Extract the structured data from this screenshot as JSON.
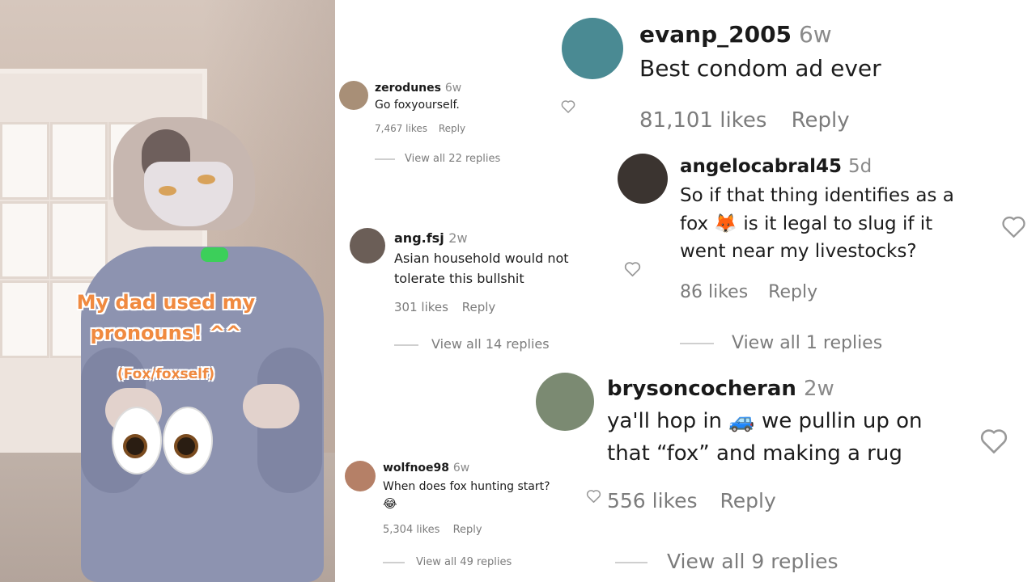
{
  "video": {
    "caption_main": "My dad used my pronouns! ^^",
    "caption_sub": "(Fox/foxself)"
  },
  "comments": [
    {
      "username": "zerodunes",
      "age": "6w",
      "text": "Go foxyourself.",
      "likes": "7,467 likes",
      "reply": "Reply",
      "view_all": "View all 22 replies"
    },
    {
      "username": "ang.fsj",
      "age": "2w",
      "text_line1": "Asian household would not",
      "text_line2": "tolerate this bullshit",
      "likes": "301 likes",
      "reply": "Reply",
      "view_all": "View all 14 replies"
    },
    {
      "username": "wolfnoe98",
      "age": "6w",
      "text": "When does fox hunting start?",
      "emoji": "😂",
      "likes": "5,304 likes",
      "reply": "Reply",
      "view_all": "View all 49 replies"
    },
    {
      "username": "evanp_2005",
      "age": "6w",
      "text": "Best condom ad ever",
      "likes": "81,101 likes",
      "reply": "Reply"
    },
    {
      "username": "angelocabral45",
      "age": "5d",
      "text_line1": "So if that thing identifies as a",
      "text_line2a": "fox",
      "emoji": "🦊",
      "text_line2b": "is it legal to slug if it",
      "text_line3": "went near my livestocks?",
      "likes": "86 likes",
      "reply": "Reply",
      "view_all": "View all 1 replies"
    },
    {
      "username": "brysoncocheran",
      "age": "2w",
      "text_line1a": "ya'll hop in",
      "emoji": "🚙",
      "text_line1b": "we pullin up on",
      "text_line2": "that “fox” and making a rug",
      "likes": "556 likes",
      "reply": "Reply",
      "view_all": "View all 9 replies"
    }
  ],
  "icons": {
    "heart": "heart-icon",
    "accent": "#f08a40"
  }
}
